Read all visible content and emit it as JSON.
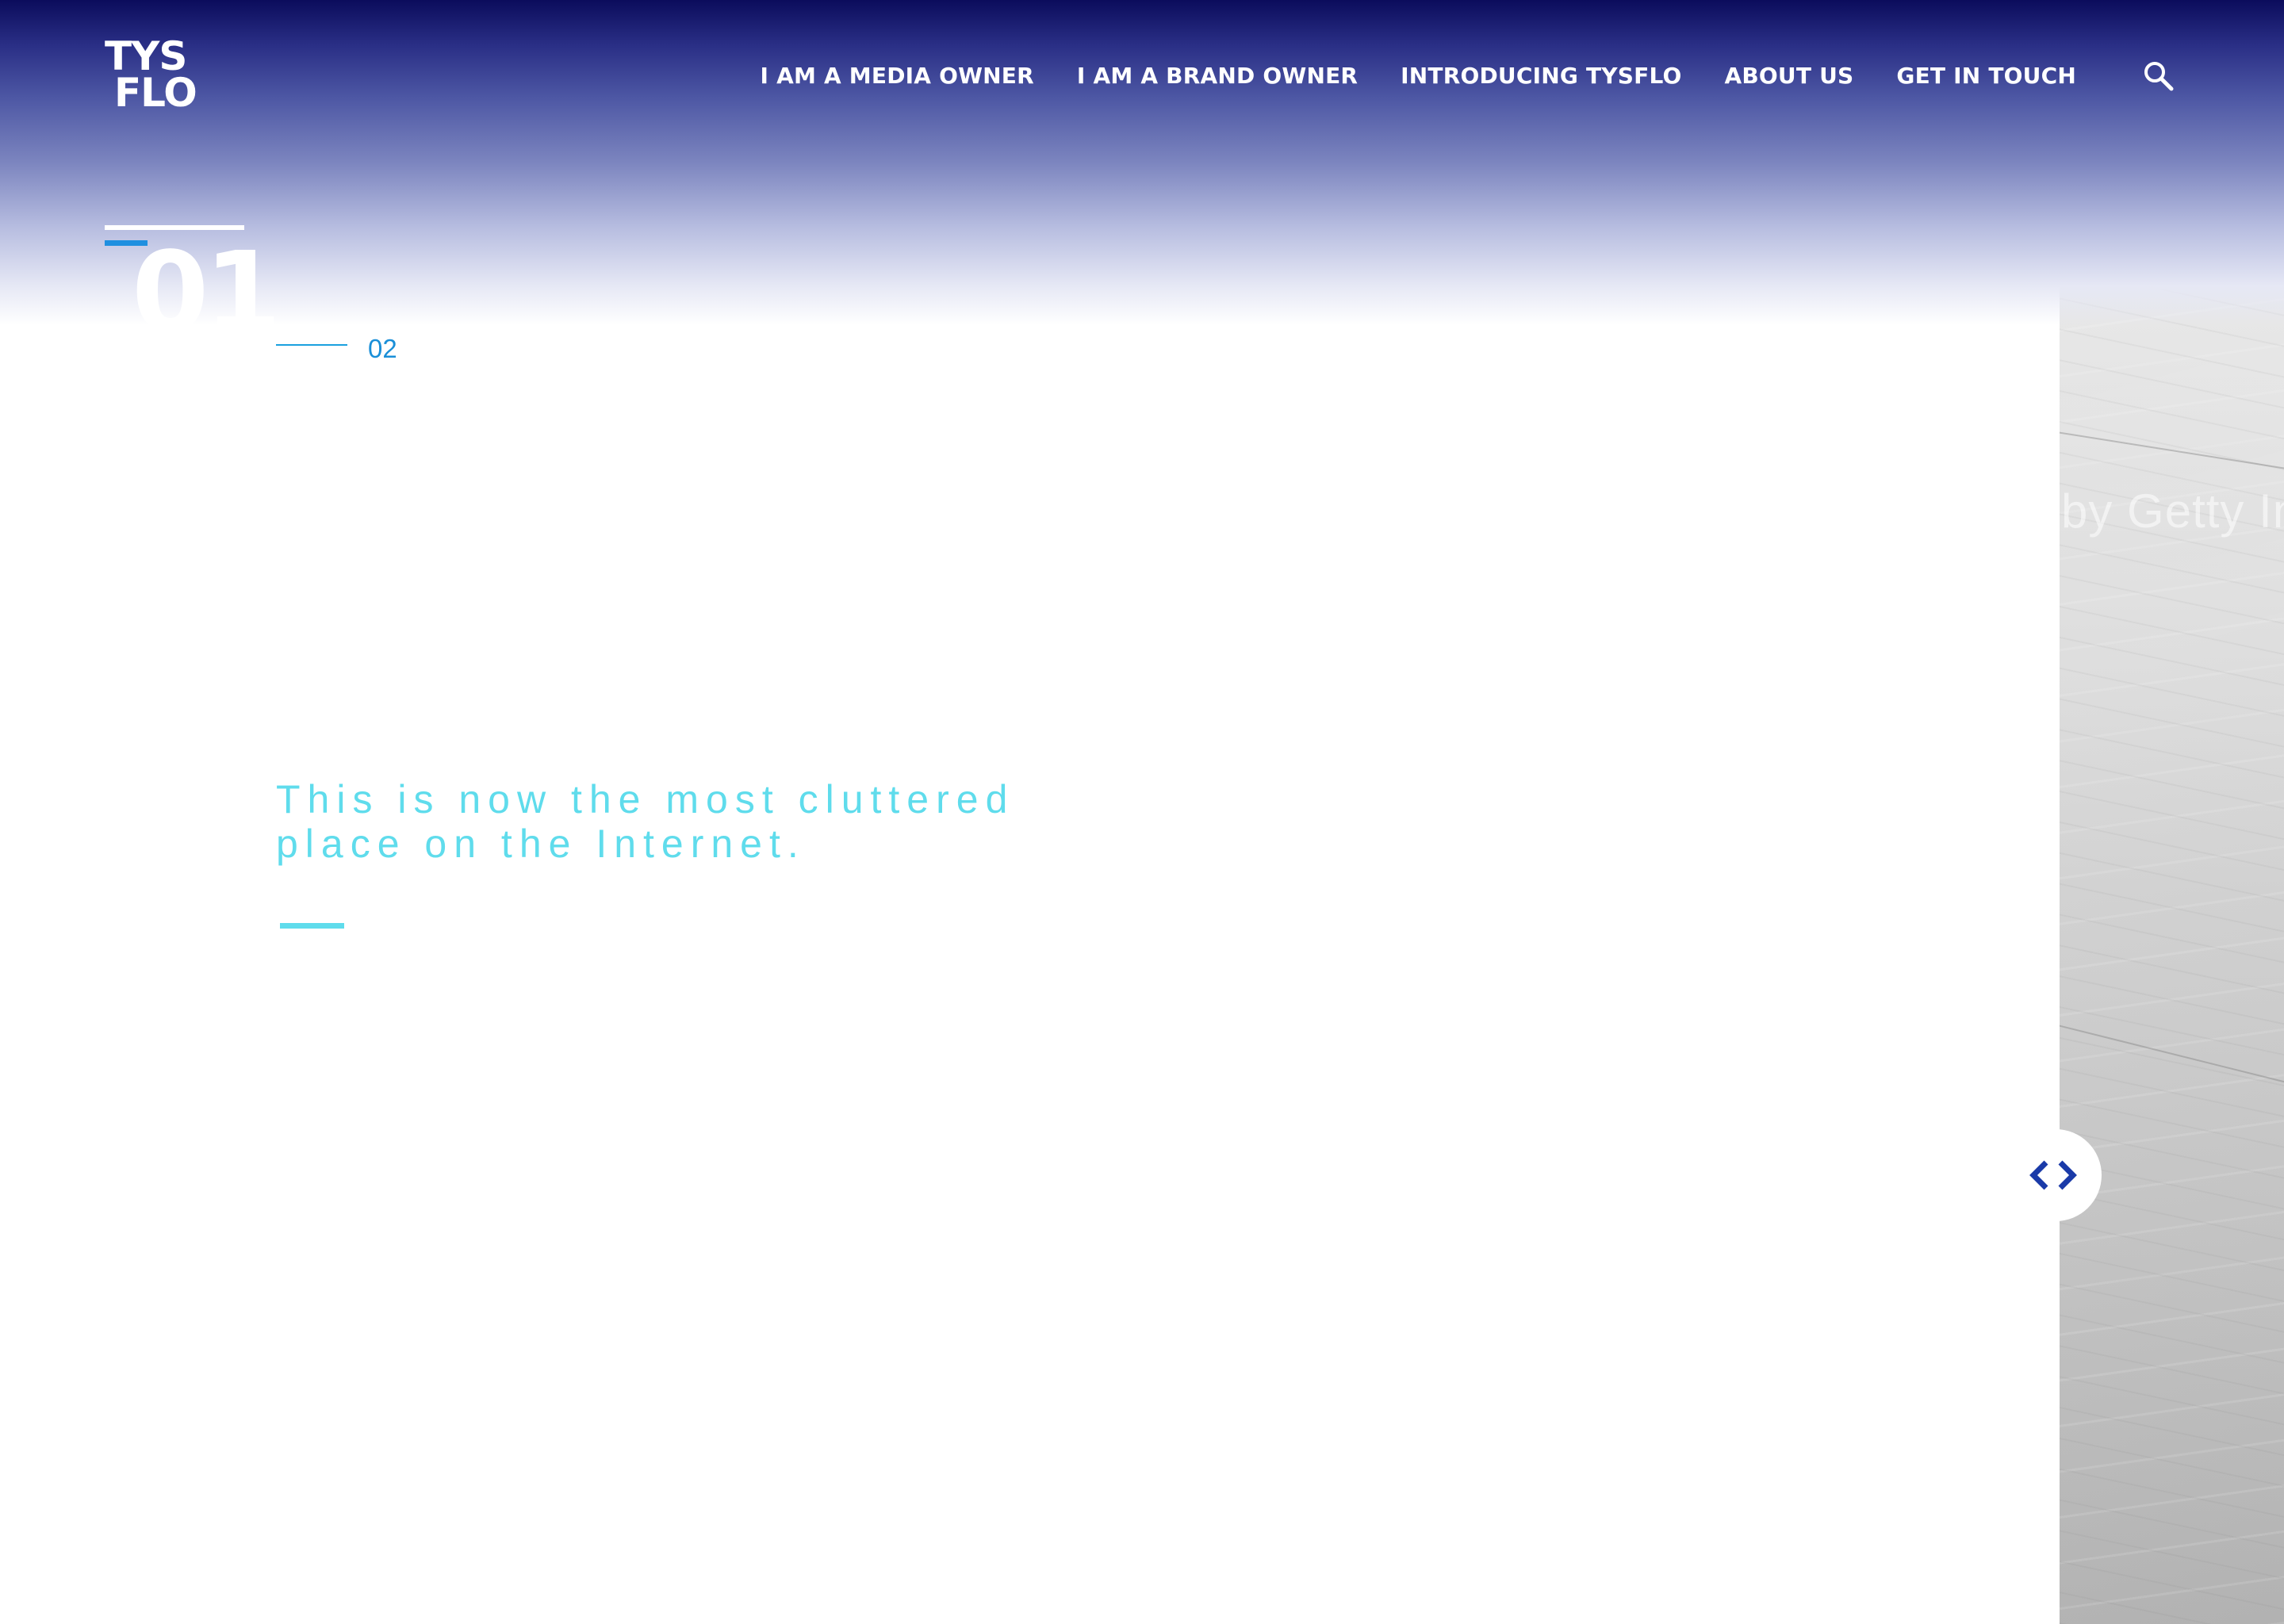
{
  "brand": {
    "logo_line1": "TYS",
    "logo_line2": "FLO"
  },
  "nav": {
    "items": [
      {
        "label": "I AM A MEDIA OWNER"
      },
      {
        "label": "I AM A BRAND OWNER"
      },
      {
        "label": "INTRODUCING TYSFLO"
      },
      {
        "label": "ABOUT US"
      },
      {
        "label": "GET IN TOUCH"
      }
    ],
    "search_icon": "search-icon"
  },
  "slider": {
    "current": "01",
    "next": "02",
    "headline": "This is now the most cluttered place on the Internet.",
    "prev_icon": "chevron-left-icon",
    "next_icon": "chevron-right-icon"
  },
  "side_image": {
    "watermark": "by Getty Im"
  },
  "colors": {
    "header_dark": "#0b0c5c",
    "accent_blue": "#1f8fe0",
    "headline_cyan": "#5fdcec",
    "arrow_blue": "#1a3aa8"
  }
}
